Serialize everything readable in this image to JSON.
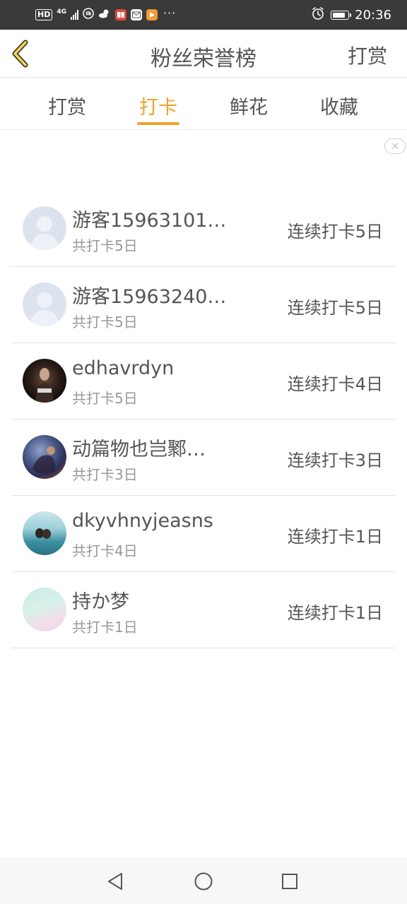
{
  "status_bar": {
    "hd": "HD",
    "network": "4G",
    "time": "20:36",
    "icons": [
      "hd-icon",
      "signal-icon",
      "hand-icon",
      "weather-icon",
      "book-app-icon",
      "huawei-mail-icon",
      "video-app-icon",
      "more-dots-icon",
      "alarm-icon",
      "battery-icon"
    ]
  },
  "header": {
    "title": "粉丝荣誉榜",
    "action": "打赏",
    "back_icon": "chevron-left-icon"
  },
  "tabs": [
    {
      "label": "打赏",
      "active": false
    },
    {
      "label": "打卡",
      "active": true
    },
    {
      "label": "鲜花",
      "active": false
    },
    {
      "label": "收藏",
      "active": false
    }
  ],
  "accent_color": "#eea32c",
  "ad_close": "×",
  "rows": [
    {
      "name": "游客15963101…",
      "total": "共打卡5日",
      "streak": "连续打卡5日",
      "avatar": "default-user-avatar"
    },
    {
      "name": "游客15963240…",
      "total": "共打卡5日",
      "streak": "连续打卡5日",
      "avatar": "default-user-avatar"
    },
    {
      "name": "edhavrdyn",
      "total": "共打卡5日",
      "streak": "连续打卡4日",
      "avatar": "photo-avatar"
    },
    {
      "name": "动篇物也岂鄹…",
      "total": "共打卡3日",
      "streak": "连续打卡3日",
      "avatar": "photo-avatar"
    },
    {
      "name": "dkyvhnyjeasns",
      "total": "共打卡4日",
      "streak": "连续打卡1日",
      "avatar": "photo-avatar"
    },
    {
      "name": "持か梦",
      "total": "共打卡1日",
      "streak": "连续打卡1日",
      "avatar": "photo-avatar"
    }
  ],
  "nav_bar": {
    "icons": [
      "back-triangle-icon",
      "home-circle-icon",
      "recents-square-icon"
    ]
  }
}
